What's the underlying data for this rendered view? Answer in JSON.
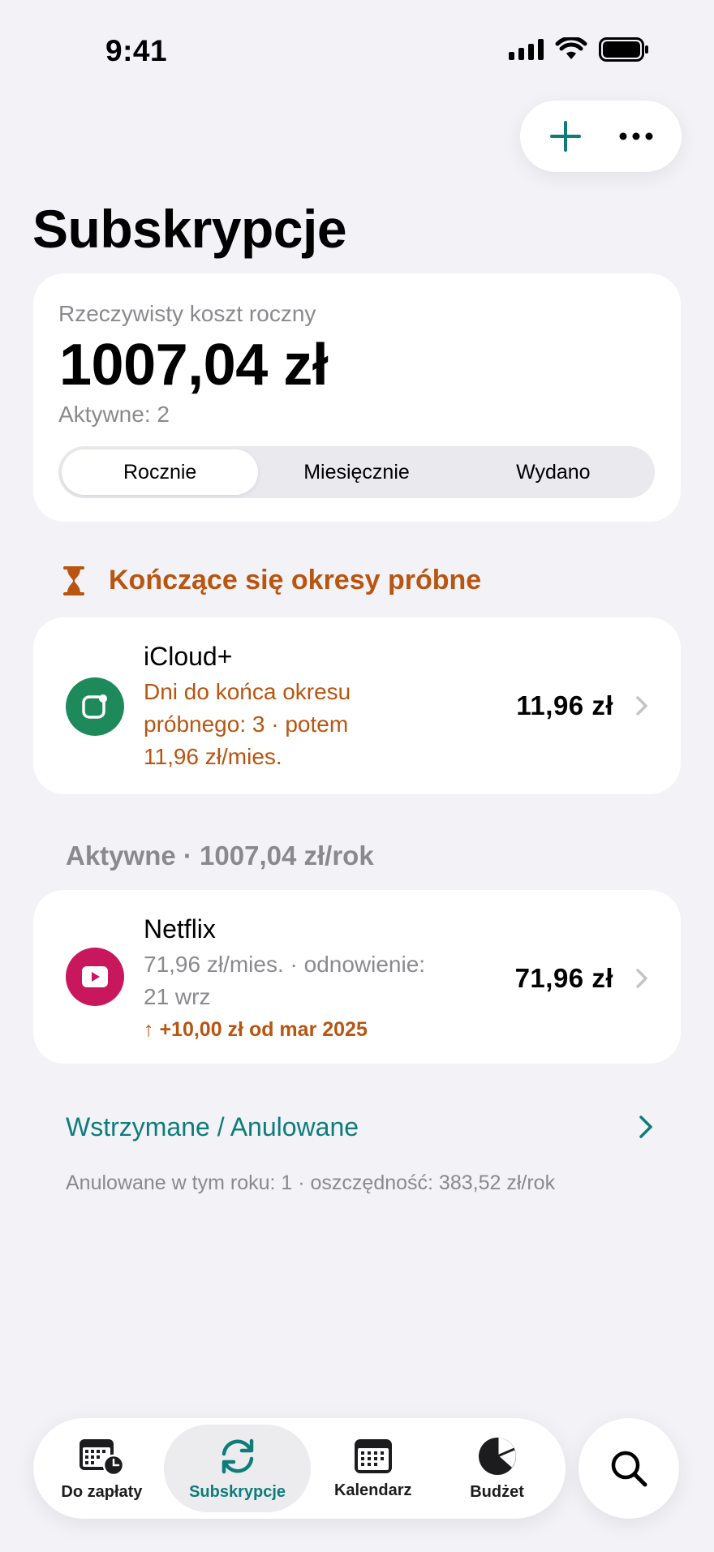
{
  "status_bar": {
    "time": "9:41"
  },
  "header": {
    "title": "Subskrypcje"
  },
  "summary": {
    "label": "Rzeczywisty koszt roczny",
    "amount": "1007,04 zł",
    "active_count": "Aktywne: 2",
    "segments": [
      "Rocznie",
      "Miesięcznie",
      "Wydano"
    ],
    "selected_segment": "Rocznie"
  },
  "trials": {
    "header": "Kończące się okresy próbne",
    "items": [
      {
        "name": "iCloud+",
        "detail_line1": "Dni do końca okresu",
        "detail_line2": "próbnego: 3 · potem",
        "detail_line3": "11,96 zł/mies.",
        "price": "11,96 zł",
        "icon": "icloud-icon",
        "icon_color": "#1E8A5C"
      }
    ]
  },
  "active": {
    "header": "Aktywne · 1007,04 zł/rok",
    "items": [
      {
        "name": "Netflix",
        "detail_line1": "71,96 zł/mies. · odnowienie:",
        "detail_line2": "21 wrz",
        "change": "↑ +10,00 zł od mar 2025",
        "price": "71,96 zł",
        "icon": "play-icon",
        "icon_color": "#C8175D"
      }
    ]
  },
  "paused": {
    "link_label": "Wstrzymane / Anulowane",
    "note": "Anulowane w tym roku: 1 · oszczędność: 383,52 zł/rok"
  },
  "tab_bar": {
    "tabs": [
      {
        "label": "Do zapłaty",
        "icon": "calendar-clock-icon"
      },
      {
        "label": "Subskrypcje",
        "icon": "sync-icon",
        "active": true
      },
      {
        "label": "Kalendarz",
        "icon": "calendar-icon"
      },
      {
        "label": "Budżet",
        "icon": "pie-chart-icon"
      }
    ]
  },
  "colors": {
    "accent": "#0E7C7B",
    "warning": "#B85510",
    "background": "#F2F2F7"
  }
}
